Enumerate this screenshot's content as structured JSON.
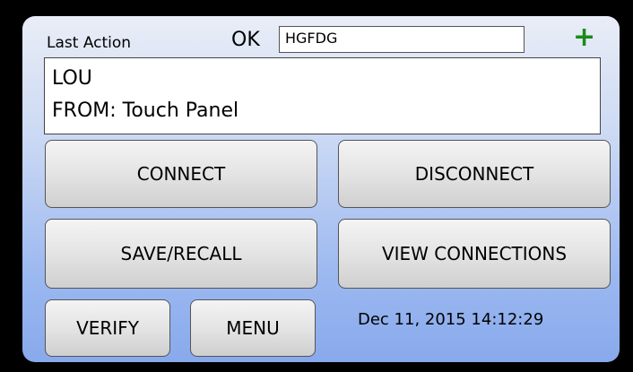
{
  "header": {
    "last_action_label": "Last Action",
    "status": "OK",
    "name_value": "HGFDG",
    "add_icon_glyph": "+"
  },
  "message": {
    "lines": [
      "LOU",
      "FROM: Touch Panel"
    ]
  },
  "buttons": {
    "connect": "CONNECT",
    "disconnect": "DISCONNECT",
    "save_recall": "SAVE/RECALL",
    "view_connections": "VIEW CONNECTIONS",
    "verify": "VERIFY",
    "menu": "MENU"
  },
  "footer": {
    "timestamp": "Dec 11, 2015 14:12:29"
  },
  "colors": {
    "add_icon": "#1a8a1a",
    "panel_gradient_top": "#e9edf6",
    "panel_gradient_bottom": "#88a9ec"
  },
  "icons": {
    "add": "plus-icon"
  }
}
